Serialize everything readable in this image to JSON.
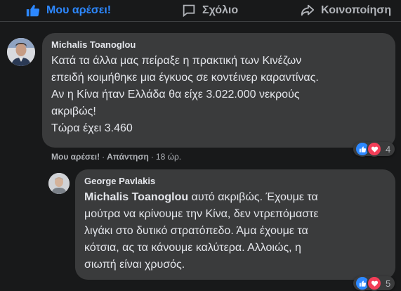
{
  "actions": {
    "like_label": "Μου αρέσει!",
    "comment_label": "Σχόλιο",
    "share_label": "Κοινοποίηση"
  },
  "comment1": {
    "author": "Michalis Toanoglou",
    "text": "Κατά τα άλλα μας πείραξε η πρακτική των Κινέζων\nεπειδή κοιμήθηκε μια έγκυος σε κοντέινερ καραντίνας.\nΑν η Κίνα ήταν Ελλάδα θα είχε 3.022.000 νεκρούς\nακριβώς!\nΤώρα έχει 3.460",
    "like_label": "Μου αρέσει!",
    "reply_label": "Απάντηση",
    "time": "18 ώρ.",
    "reaction_count": "4"
  },
  "comment2": {
    "author": "George Pavlakis",
    "mention": "Michalis Toanoglou",
    "text": " αυτό ακριβώς. Έχουμε τα\nμούτρα να κρίνουμε την Κίνα, δεν ντρεπόμαστε\nλιγάκι στο δυτικό στρατόπεδο. Άμα έχουμε τα\nκότσια, ας τα κάνουμε καλύτερα. Αλλοιώς, η\nσιωπή είναι χρυσός.",
    "reaction_count": "5"
  },
  "colors": {
    "background": "#18191a",
    "bubble": "#3a3b3c",
    "text": "#e4e6eb",
    "secondary": "#b0b3b8",
    "like_blue": "#2d88ff",
    "love_red": "#f33e58"
  },
  "icons": [
    "thumbs-up-icon",
    "comment-icon",
    "share-icon",
    "like-reaction-icon",
    "love-reaction-icon"
  ]
}
